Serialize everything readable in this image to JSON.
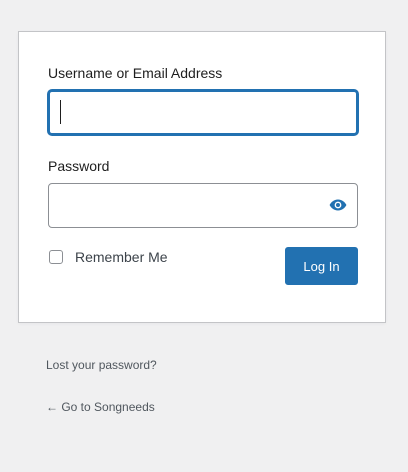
{
  "login_form": {
    "username_label": "Username or Email Address",
    "username_value": "",
    "password_label": "Password",
    "password_value": "",
    "show_password_icon": "eye-icon",
    "remember_label": "Remember Me",
    "remember_checked": false,
    "submit_label": "Log In"
  },
  "links": {
    "lost_password": "Lost your password?",
    "back_to_site": "← Go to Songneeds"
  },
  "colors": {
    "background": "#f0f0f1",
    "card": "#ffffff",
    "accent": "#2271b1",
    "text": "#3c434a"
  }
}
